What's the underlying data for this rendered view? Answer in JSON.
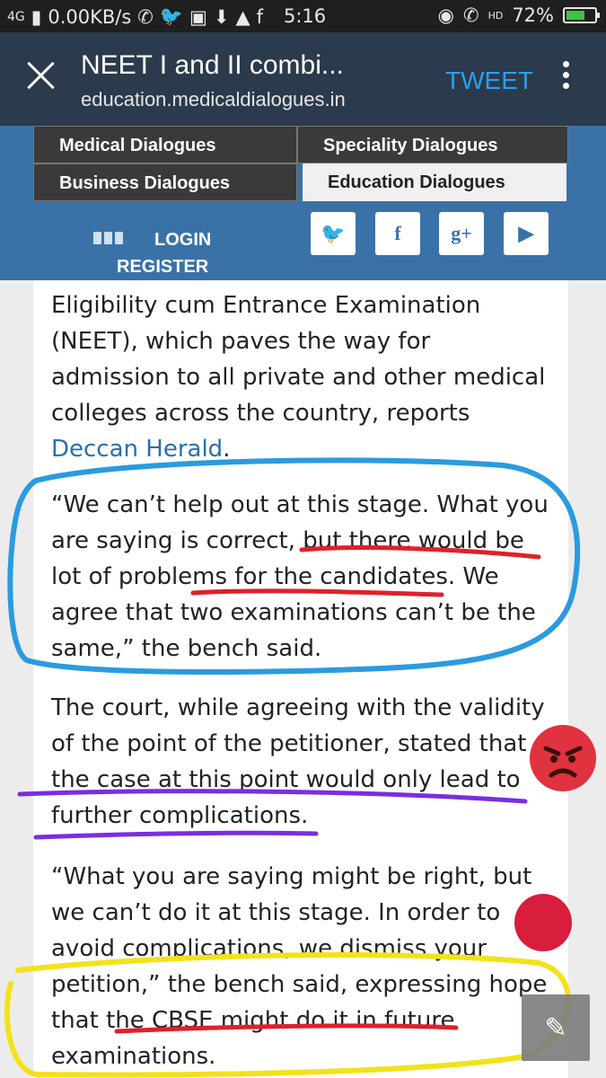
{
  "status_bar": {
    "network": "4G",
    "speed": "0.00KB/s",
    "time": "5:16",
    "hd": "HD",
    "battery": "72%",
    "battery_level": 0.72,
    "icons": [
      "signal-icon",
      "whatsapp-icon",
      "twitter-icon",
      "message-icon",
      "download-icon",
      "warning-icon",
      "facebook-icon",
      "eye-icon",
      "wifi-call-icon",
      "battery-icon"
    ]
  },
  "app_bar": {
    "title": "NEET I and II combi...",
    "url": "education.medicaldialogues.in",
    "tweet_label": "TWEET",
    "icons": [
      "close-icon",
      "more-vert-icon"
    ]
  },
  "site_nav": {
    "items": [
      {
        "label": "Medical Dialogues",
        "active": false
      },
      {
        "label": "Speciality Dialogues",
        "active": false
      },
      {
        "label": "Business Dialogues",
        "active": false
      },
      {
        "label": "Education Dialogues",
        "active": true
      }
    ],
    "login": "LOGIN",
    "register": "REGISTER",
    "social": [
      {
        "name": "twitter-icon",
        "glyph": "🐦"
      },
      {
        "name": "facebook-icon",
        "glyph": "f"
      },
      {
        "name": "google-plus-icon",
        "glyph": "g+"
      },
      {
        "name": "youtube-icon",
        "glyph": "▶"
      }
    ]
  },
  "article": {
    "p1_lines": [
      "Eligibility cum Entrance Examination",
      "(NEET), which paves the way for",
      "admission to all private and other medical",
      "colleges across the country, reports"
    ],
    "p1_link": "Deccan Herald",
    "p1_end": ".",
    "p2_lines": [
      "“We can’t help out at this stage. What you",
      "are saying is correct, but there would be",
      "lot of problems for the candidates. We",
      "agree that two examinations can’t be the",
      "same,” the bench said."
    ],
    "p3_lines": [
      "The court, while agreeing with the validity",
      "of the point of the petitioner, stated that",
      "the case at this point would only lead to",
      "further complications."
    ],
    "p4_lines": [
      "“What you are saying might be right, but",
      "we can’t do it at this stage. In order to",
      "avoid complications, we dismiss your",
      "petition,” the bench said, expressing hope",
      "that the CBSE might do it in future",
      "examinations."
    ]
  },
  "annotations": {
    "blue": "#2a9be0",
    "red": "#e0202a",
    "purple": "#7a2ee0",
    "yellow": "#f2e21a"
  },
  "overlays": {
    "angry_emoji": "😡",
    "edit_icon": "✎"
  }
}
